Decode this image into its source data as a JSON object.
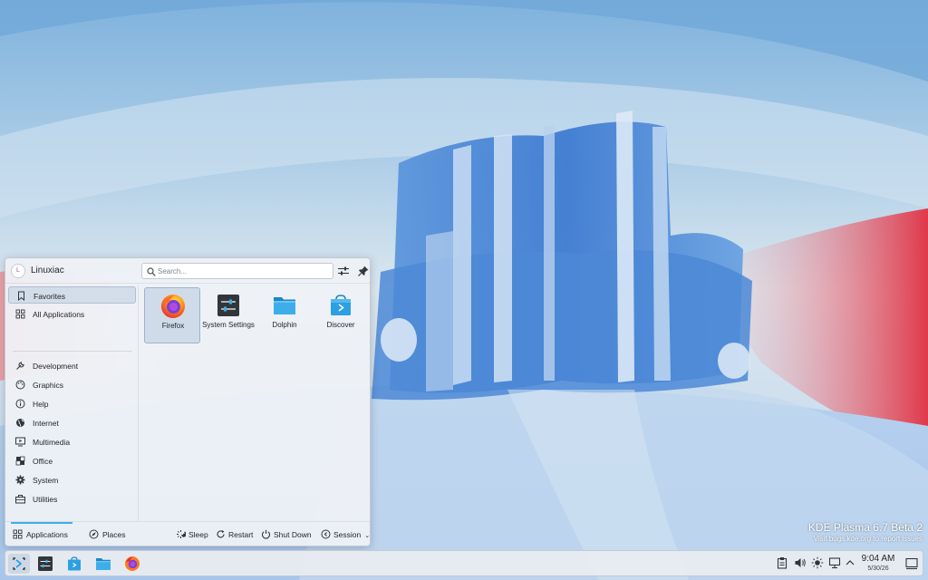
{
  "watermark": {
    "title": "KDE Plasma 6.7 Beta 2",
    "subtitle": "Visit bugs.kde.org to report issues"
  },
  "launcher": {
    "user": {
      "avatar_initial": "L",
      "name": "Linuxiac"
    },
    "search": {
      "placeholder": "Search..."
    },
    "categories": [
      {
        "label": "Favorites",
        "icon": "bookmark-icon",
        "active": true
      },
      {
        "label": "All Applications",
        "icon": "grid-icon"
      },
      {
        "label": "Development",
        "icon": "wrench-icon"
      },
      {
        "label": "Graphics",
        "icon": "palette-icon"
      },
      {
        "label": "Help",
        "icon": "help-icon"
      },
      {
        "label": "Internet",
        "icon": "globe-icon"
      },
      {
        "label": "Multimedia",
        "icon": "monitor-play-icon"
      },
      {
        "label": "Office",
        "icon": "office-icon"
      },
      {
        "label": "System",
        "icon": "gear-icon"
      },
      {
        "label": "Utilities",
        "icon": "toolbox-icon"
      }
    ],
    "favorites": [
      {
        "label": "Firefox",
        "icon": "firefox-icon",
        "selected": true
      },
      {
        "label": "System Settings",
        "icon": "system-settings-icon"
      },
      {
        "label": "Dolphin",
        "icon": "dolphin-folder-icon"
      },
      {
        "label": "Discover",
        "icon": "discover-icon"
      }
    ],
    "footer": {
      "tabs": [
        {
          "label": "Applications",
          "icon": "grid-icon",
          "active": true
        },
        {
          "label": "Places",
          "icon": "compass-icon"
        }
      ],
      "power": [
        {
          "label": "Sleep",
          "icon": "sleep-icon"
        },
        {
          "label": "Restart",
          "icon": "restart-icon"
        },
        {
          "label": "Shut Down",
          "icon": "power-icon"
        },
        {
          "label": "Session",
          "icon": "session-icon"
        }
      ]
    }
  },
  "taskbar": {
    "items": [
      "application-launcher-icon",
      "system-settings-icon",
      "discover-icon",
      "dolphin-folder-icon",
      "firefox-icon"
    ],
    "tray": [
      "clipboard-icon",
      "volume-icon",
      "brightness-icon",
      "network-icon",
      "chevron-up-icon"
    ],
    "clock": {
      "time": "9:04 AM",
      "date": "5/30/26"
    }
  },
  "colors": {
    "accent": "#3daee9",
    "panel": "#e8ecf1",
    "launcher_bg": "#eff2f6"
  }
}
